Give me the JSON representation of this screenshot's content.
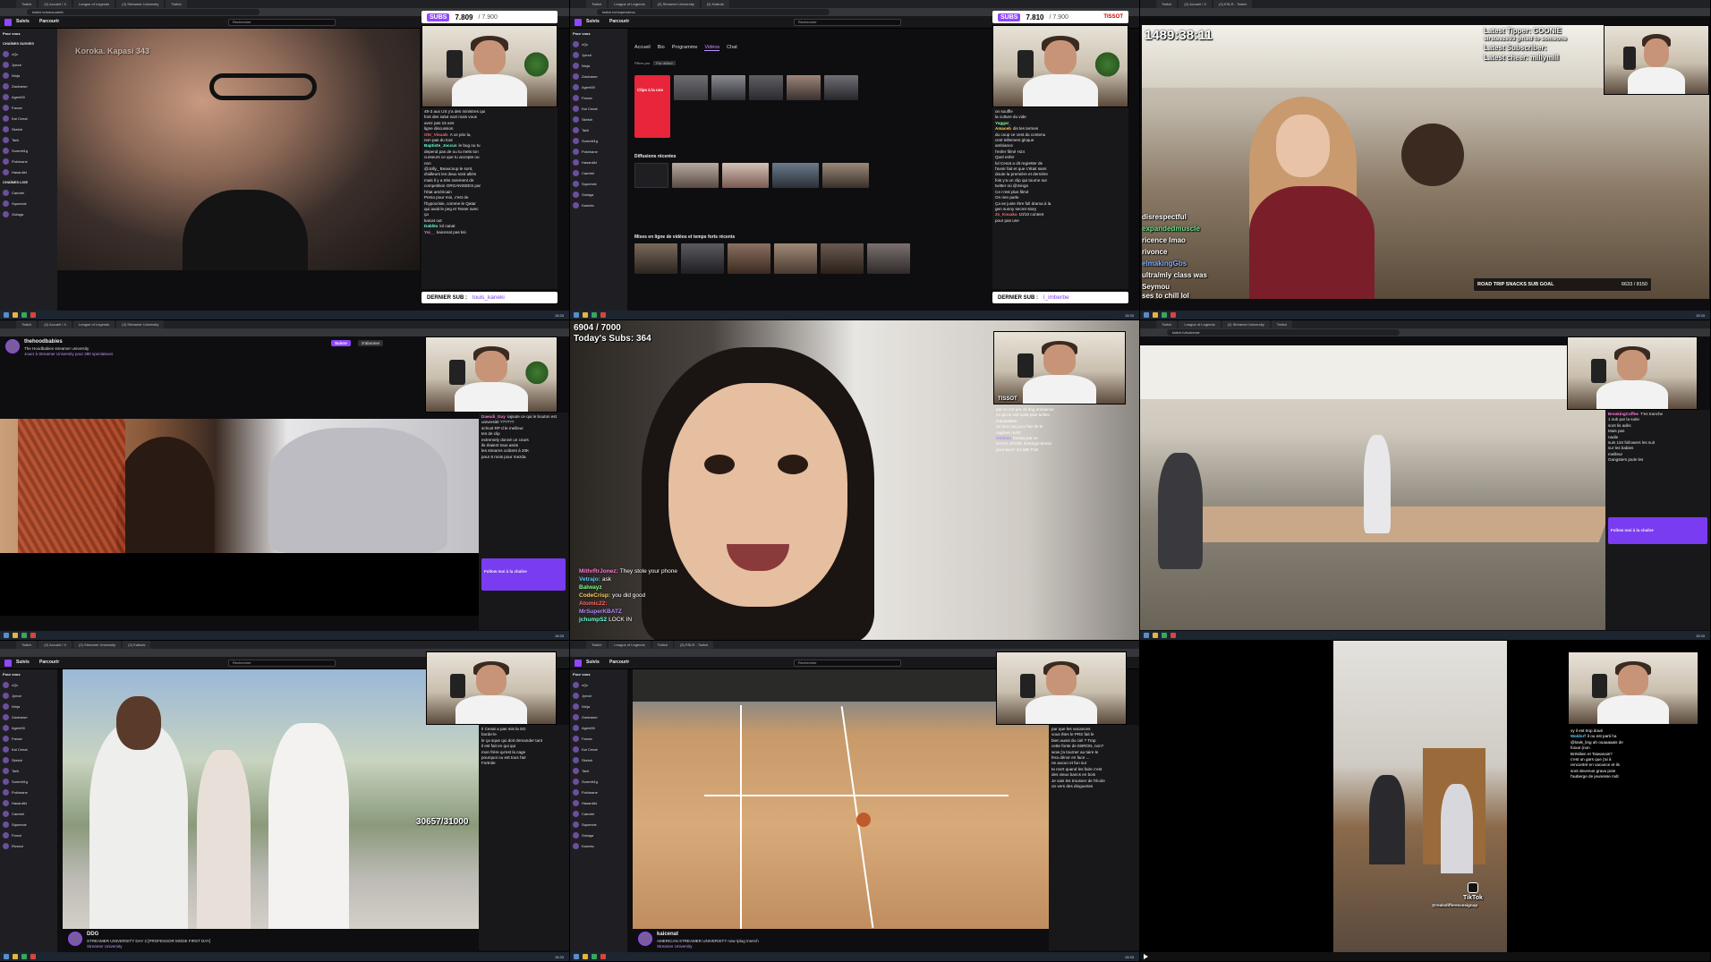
{
  "browser": {
    "tabs": [
      "Twitch",
      "(2) Accueil / X",
      "League of Legends",
      "(2) Streamer University",
      "Twitch",
      "(2) Kaikuts",
      "(3) ESLR - Twitch"
    ],
    "url_1": "twitch.tv/amouranth",
    "url_2": "twitch.tv/ninja/videos",
    "url_6": "twitch.tv/kaicenat"
  },
  "twitch_nav": {
    "following": "Suivis",
    "browse": "Parcourir",
    "search_placeholder": "Rechercher"
  },
  "sidebar": {
    "header_for_you": "Pour vous",
    "header_followed": "CHAÎNES SUIVIES",
    "header_live": "CHAÎNES LIVE",
    "channels": [
      "xQc",
      "Jynxzi",
      "Ninja",
      "Zackrawrr",
      "Agent00",
      "Fanum",
      "Kai Cenat",
      "Sketch",
      "Tarik",
      "Summit1g",
      "Pokimane",
      "HasanAbi",
      "Caedrel",
      "Squeezie",
      "Gotaga",
      "Kameto",
      "Ponce",
      "Rivenzi"
    ]
  },
  "panel1": {
    "subs_label": "SUBS",
    "subs_value": "7.809",
    "subs_max": "/ 7.900",
    "last_sub_label": "DERNIER SUB :",
    "last_sub_name": "louis_kaneki",
    "chat": [
      {
        "user": "",
        "text": "49-3 aux US y'a des ministres qui"
      },
      {
        "user": "",
        "text": "font des salut nazi mais vous"
      },
      {
        "user": "",
        "text": "avez pas 15 ans"
      },
      {
        "user": "",
        "text": "ligne discussion"
      },
      {
        "user": "Ohr_Visuals",
        "text": "A ce prix la,"
      },
      {
        "user": "",
        "text": "non pas du tout"
      },
      {
        "user": "Baptiste_Joccus",
        "text": "le bug ou tu"
      },
      {
        "user": "",
        "text": "depend pas de ou tu mets ton"
      },
      {
        "user": "",
        "text": "curseurs ce que tu accepte ou"
      },
      {
        "user": "",
        "text": "non"
      },
      {
        "user": "",
        "text": "@Jolly_ Beaucoup le sont,"
      },
      {
        "user": "",
        "text": "d'ailleurs les deux sont alliés"
      },
      {
        "user": "",
        "text": "mais il y a très rarement de"
      },
      {
        "user": "",
        "text": "competition ORGANISEES par"
      },
      {
        "user": "",
        "text": "l'état américain"
      },
      {
        "user": "",
        "text": "Perso pour moi, c'est de"
      },
      {
        "user": "",
        "text": "l'hypocrisie, comme le Qatar"
      },
      {
        "user": "",
        "text": "qui avait le peg et Texter avec"
      },
      {
        "user": "",
        "text": "ça"
      },
      {
        "user": "",
        "text": "kaicat out"
      },
      {
        "user": "Dabl0u",
        "text": "lol canat"
      },
      {
        "user": "Yoi__",
        "text": "kaicenat pas ksi"
      }
    ],
    "overlay_text": "Koroka. Kapasi 343"
  },
  "panel2": {
    "subs_label": "SUBS",
    "subs_value": "7.810",
    "subs_max": "/ 7.900",
    "sponsor": "TISSOT",
    "last_sub_label": "DERNIER SUB :",
    "last_sub_name": "l_imberbe",
    "tabs": [
      "Accueil",
      "Bio",
      "Programme",
      "Vidéos",
      "Chat"
    ],
    "section_recent": "Diffusions récentes",
    "section_highlights": "Mises en ligne de vidéos et temps forts récents",
    "filter_label": "Filtrer par",
    "sort_label": "Par défaut",
    "clip_label": "Clips à la une",
    "chat": [
      {
        "user": "",
        "text": "on souffle"
      },
      {
        "user": "",
        "text": "la culture du vide"
      },
      {
        "user": "Yaggar_",
        "text": ""
      },
      {
        "user": "Amaceb",
        "text": "dis les termes"
      },
      {
        "user": "",
        "text": "du coup ce cest du contenu"
      },
      {
        "user": "",
        "text": "cest tellement gloque"
      },
      {
        "user": "",
        "text": "ambiance"
      },
      {
        "user": "",
        "text": "l'enfer filmé H24"
      },
      {
        "user": "",
        "text": "Quel enfer"
      },
      {
        "user": "",
        "text": "lol Cenat a dit regretter de"
      },
      {
        "user": "",
        "text": "l'avoir fait et que c'était sans"
      },
      {
        "user": "",
        "text": "doute la première et dernière"
      },
      {
        "user": "",
        "text": "fois y'a un clip qui tourne sur"
      },
      {
        "user": "",
        "text": "twitter où @mingo"
      },
      {
        "user": "",
        "text": "Ce n'est plus filmé"
      },
      {
        "user": "",
        "text": "On rien parle"
      },
      {
        "user": "",
        "text": "Ça se juste être full drama à la"
      },
      {
        "user": "",
        "text": "gen sunny secret story"
      },
      {
        "user": "Zx_Kouaka",
        "text": "10/10 content"
      },
      {
        "user": "",
        "text": "pour pas une"
      }
    ]
  },
  "panel3": {
    "timer": "1489:38:11",
    "latest_tipper": "Latest Tipper: GOONIE",
    "latest_gift": "sirsteeze93 gifted to someone",
    "latest_subscriber": "Latest Subscriber:",
    "latest_cheer": "Latest cheer: millymill",
    "subgoal_label": "ROAD TRIP SNACKS SUB GOAL",
    "subgoal_value": "6633 / 8150",
    "overlay_left": "disrespectful",
    "overlay_left2": "expandedmuscle",
    "overlay_left3": "ricence lmao",
    "overlay_left4": "rivonce",
    "overlay_left5": "elmakingGbs",
    "overlay_left6": "ultra/mly class was",
    "overlay_left7": "Seymou",
    "overlay_left8": "ses to chill lol"
  },
  "panel4": {
    "channel_name": "thehoodbabies",
    "channel_title": "The Hoodbabies streamer university",
    "channel_sub": "Jouer à Streamer University pour 390 spectateurs",
    "follow": "Suivre",
    "subscribe": "S'abonner",
    "chat": [
      {
        "user": "Daeudi_Guy",
        "text": "rajoute ce qui le bouton est"
      },
      {
        "user": "",
        "text": "université ??????"
      },
      {
        "user": "",
        "text": "school RP d le meilleur"
      },
      {
        "user": "",
        "text": "tes de clip"
      },
      {
        "user": "",
        "text": "extremely donné un cours"
      },
      {
        "user": "",
        "text": "ils étaient tous assis"
      },
      {
        "user": "",
        "text": "les streams coûtent à 20K"
      },
      {
        "user": "",
        "text": "pour 6 mois pour mezda"
      }
    ],
    "promo_text": "Follow moi à la chaîne"
  },
  "panel5": {
    "subs_progress": "6904 / 7000",
    "todays_subs": "Today's Subs: 364",
    "sponsor": "TISSOT",
    "chat": [
      {
        "user": "MithrRrJonez:",
        "text": "They stole your phone"
      },
      {
        "user": "Vetrajo:",
        "text": "ask"
      },
      {
        "user": "Balwayz",
        "text": ""
      },
      {
        "user": "CodeCrisp:",
        "text": "you did good"
      },
      {
        "user": "Atomic22:",
        "text": ""
      },
      {
        "user": "MrSuperKBATZ",
        "text": ""
      },
      {
        "user": "jchumpS2",
        "text": "LOCK IN"
      }
    ],
    "chat_right": [
      {
        "user": "",
        "text": "par ce me pra ch dag ambiance"
      },
      {
        "user": "",
        "text": "ce qu'on soit avait plus belles"
      },
      {
        "user": "",
        "text": "intankables"
      },
      {
        "user": "",
        "text": "on tout coq ça a l'air de le"
      },
      {
        "user": "",
        "text": "captiver mdrrr"
      },
      {
        "user": "Oshima",
        "text": "Kossai par ce"
      },
      {
        "user": "",
        "text": "KOHO JESSE domingo domin"
      },
      {
        "user": "",
        "text": "pour leux? CA ME TUE"
      }
    ]
  },
  "panel6": {
    "chat": [
      {
        "user": "BreakingCoffee",
        "text": "T'es tranche"
      },
      {
        "user": "",
        "text": "1 sub par la suite"
      },
      {
        "user": "",
        "text": "sont lis adès"
      },
      {
        "user": "",
        "text": "Mais pas"
      },
      {
        "user": "",
        "text": "nadie"
      },
      {
        "user": "",
        "text": "suis 134 followers les suit"
      },
      {
        "user": "",
        "text": "sur les babies"
      },
      {
        "user": "",
        "text": "meilleur"
      },
      {
        "user": "",
        "text": "Gangsters joule les"
      }
    ],
    "promo_text": "Follow moi à la chaîne"
  },
  "panel7": {
    "overlay_subs": "30657/31000",
    "channel_name": "DDG",
    "channel_title": "STREAMER UNIVERSITY DAY 2 [PROFESSOR MODE FIRST DAY]",
    "channel_sub": "Streamer University",
    "chat": [
      {
        "user": "",
        "text": "Il Cenat a pas mis la SG"
      },
      {
        "user": "",
        "text": "borde-le"
      },
      {
        "user": "",
        "text": "le ça sque qui doit demander tant"
      },
      {
        "user": "",
        "text": "il est fait en qui qui"
      },
      {
        "user": "",
        "text": "mon frère qu'est la cage"
      },
      {
        "user": "",
        "text": "pourquoi ou est tous l'air"
      },
      {
        "user": "",
        "text": "Fortnite"
      }
    ]
  },
  "panel8": {
    "channel_name": "kaicenat",
    "channel_title": "AMERICAN STREAMER UNIVERSITY now !plug !merch",
    "channel_sub": "Streamer University",
    "chat": [
      {
        "user": "",
        "text": "par que les vacances"
      },
      {
        "user": "",
        "text": "vous êtes le PRS fait le"
      },
      {
        "user": "",
        "text": "bien aussi du ciel ? Trop"
      },
      {
        "user": "",
        "text": "cette fonte de EBRON, non?"
      },
      {
        "user": "",
        "text": "wow j'a tourner au taire le"
      },
      {
        "user": "",
        "text": "fera dénor en face ..."
      },
      {
        "user": "",
        "text": "ne aucun et fun sur"
      },
      {
        "user": "",
        "text": "ta mort quand les faire c'est"
      },
      {
        "user": "",
        "text": "des vieux bancs en bois"
      },
      {
        "user": "",
        "text": "Je vais les trousser de l'école"
      },
      {
        "user": "",
        "text": "on vers des dingueries"
      }
    ]
  },
  "panel9": {
    "watermark": "TikTok",
    "watermark_handle": "@realsdifferencesignup",
    "chat": [
      {
        "user": "",
        "text": "vy il est trop doué"
      },
      {
        "user": "Waldorf",
        "text": "il ou est parti ha"
      },
      {
        "user": "",
        "text": "@lowk_ling ah ouaaaaais de"
      },
      {
        "user": "",
        "text": "foous (non"
      },
      {
        "user": "",
        "text": "Brésilien et Taiwanais?"
      },
      {
        "user": "",
        "text": "c'est un gars que j'ai à"
      },
      {
        "user": "",
        "text": "rencontré en vacance et ils"
      },
      {
        "user": "",
        "text": "sont devenus grava pote"
      },
      {
        "user": "",
        "text": "l'auberge de jeunesse mdr"
      }
    ]
  },
  "taskbar": {
    "time": "15:33"
  }
}
